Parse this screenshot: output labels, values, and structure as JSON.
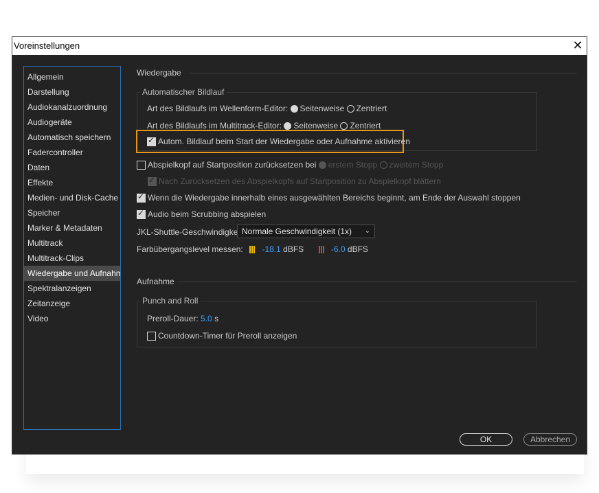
{
  "window": {
    "title": "Voreinstellungen",
    "close_label": "✕"
  },
  "sidebar": {
    "items": [
      {
        "label": "Allgemein"
      },
      {
        "label": "Darstellung"
      },
      {
        "label": "Audiokanalzuordnung"
      },
      {
        "label": "Audiogeräte"
      },
      {
        "label": "Automatisch speichern"
      },
      {
        "label": "Fadercontroller"
      },
      {
        "label": "Daten"
      },
      {
        "label": "Effekte"
      },
      {
        "label": "Medien- und Disk-Cache"
      },
      {
        "label": "Speicher"
      },
      {
        "label": "Marker & Metadaten"
      },
      {
        "label": "Multitrack"
      },
      {
        "label": "Multitrack-Clips"
      },
      {
        "label": "Wiedergabe und Aufnahme",
        "selected": true
      },
      {
        "label": "Spektralanzeigen"
      },
      {
        "label": "Zeitanzeige"
      },
      {
        "label": "Video"
      }
    ]
  },
  "playback": {
    "section_title": "Wiedergabe",
    "auto_scroll": {
      "group_title": "Automatischer Bildlauf",
      "waveform_label": "Art des Bildlaufs im Wellenform-Editor:",
      "multitrack_label": "Art des Bildlaufs im Multitrack-Editor:",
      "option_page": "Seitenweise",
      "option_centered": "Zentriert",
      "waveform_selected": "Seitenweise",
      "multitrack_selected": "Seitenweise",
      "enable_label": "Autom. Bildlauf beim Start der Wiedergabe oder Aufnahme aktivieren",
      "enable_checked": true
    },
    "reset_playhead": {
      "label": "Abspielkopf auf Startposition zurücksetzen bei",
      "checked": false,
      "option_first": "erstem Stopp",
      "option_second": "zweitem Stopp",
      "scroll_after_label": "Nach Zurücksetzen des Abspielkopfs auf Startposition zu Abspielkopf blättern",
      "scroll_after_checked": true
    },
    "stop_at_selection_end": {
      "label": "Wenn die Wiedergabe innerhalb eines ausgewählten Bereichs beginnt, am Ende der Auswahl stoppen",
      "checked": true
    },
    "audio_scrubbing": {
      "label": "Audio beim Scrubbing abspielen",
      "checked": true
    },
    "jkl": {
      "label": "JKL-Shuttle-Geschwindigkeit:",
      "selected": "Normale Geschwindigkeit (1x)"
    },
    "fade_level": {
      "label": "Farbübergangslevel messen:",
      "level1_value": "-18.1",
      "level1_unit": "dBFS",
      "level1_color": "#f2c200",
      "level2_value": "-6.0",
      "level2_unit": "dBFS",
      "level2_color": "#e23a3a"
    }
  },
  "recording": {
    "section_title": "Aufnahme",
    "punch": {
      "group_title": "Punch and Roll",
      "preroll_label": "Preroll-Dauer:",
      "preroll_value": "5.0",
      "preroll_unit": "s",
      "countdown_label": "Countdown-Timer für Preroll anzeigen",
      "countdown_checked": false
    }
  },
  "buttons": {
    "ok": "OK",
    "cancel": "Abbrechen"
  },
  "colors": {
    "highlight": "#e8961a",
    "accent_value": "#3aa0ff",
    "nav_border": "#2e6fb0"
  }
}
